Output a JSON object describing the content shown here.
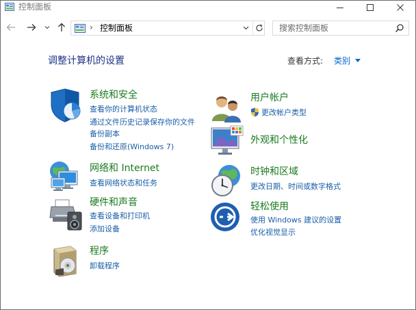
{
  "window": {
    "title": "控制面板",
    "controls": {
      "minimize": "—",
      "maximize": "☐",
      "close": "✕"
    }
  },
  "nav": {
    "address_text": "控制面板",
    "address_separator": "›",
    "search_placeholder": "搜索控制面板"
  },
  "main": {
    "page_title": "调整计算机的设置",
    "view_by_label": "查看方式:",
    "view_by_value": "类别"
  },
  "categories": {
    "system_security": {
      "title": "系统和安全",
      "icon": "shield-chart-icon",
      "links": [
        "查看你的计算机状态",
        "通过文件历史记录保存你的文件",
        "备份副本",
        "备份和还原(Windows 7)"
      ]
    },
    "network": {
      "title": "网络和 Internet",
      "icon": "network-globe-icon",
      "links": [
        "查看网络状态和任务"
      ]
    },
    "hardware": {
      "title": "硬件和声音",
      "icon": "printer-speaker-icon",
      "links": [
        "查看设备和打印机",
        "添加设备"
      ]
    },
    "programs": {
      "title": "程序",
      "icon": "programs-disc-icon",
      "links": [
        "卸载程序"
      ]
    },
    "user_accounts": {
      "title": "用户帐户",
      "icon": "users-icon",
      "links": [
        "更改帐户类型"
      ]
    },
    "appearance": {
      "title": "外观和个性化",
      "icon": "monitor-palette-icon",
      "links": []
    },
    "clock_region": {
      "title": "时钟和区域",
      "icon": "clock-globe-icon",
      "links": [
        "更改日期、时间或数字格式"
      ]
    },
    "ease_access": {
      "title": "轻松使用",
      "icon": "ease-of-access-icon",
      "links": [
        "使用 Windows 建议的设置",
        "优化视觉显示"
      ]
    }
  },
  "colors": {
    "category_title": "#197a1e",
    "link": "#1a5ea8",
    "heading": "#1e3287",
    "accent": "#0066cc"
  }
}
